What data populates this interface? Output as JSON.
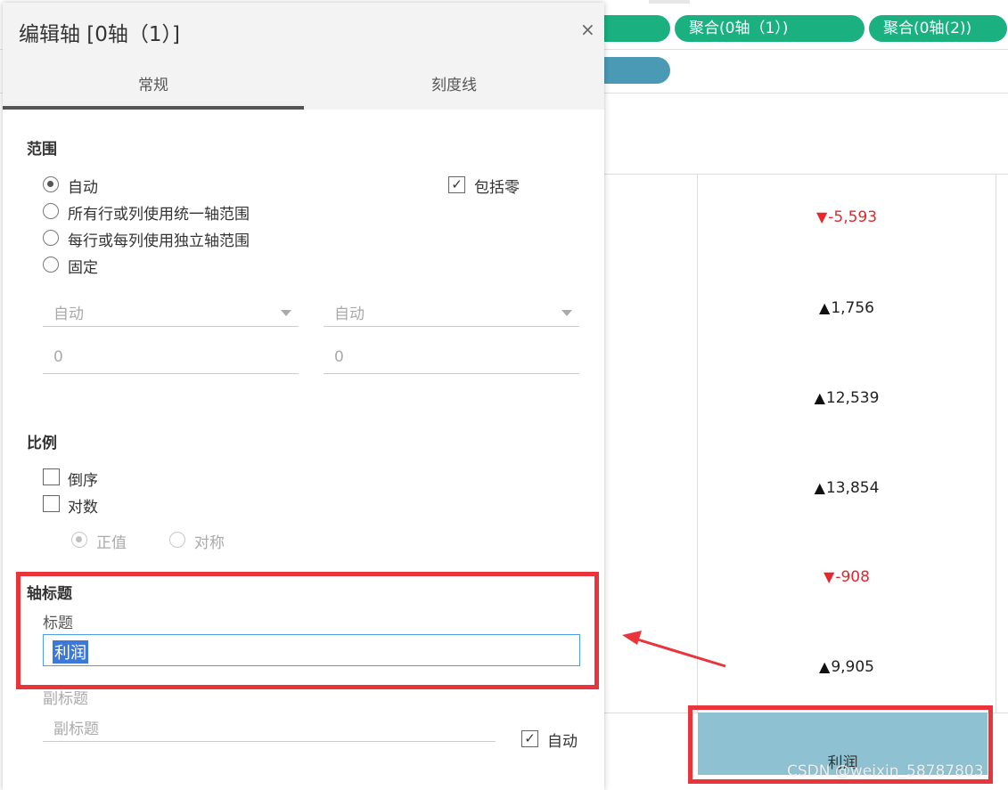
{
  "background": {
    "pills_row1": [
      "聚合(0轴（1）)",
      "聚合(0轴(2))"
    ],
    "values": [
      {
        "text": "-5,593",
        "trend": "down"
      },
      {
        "text": "1,756",
        "trend": "up"
      },
      {
        "text": "12,539",
        "trend": "up"
      },
      {
        "text": "13,854",
        "trend": "up"
      },
      {
        "text": "-908",
        "trend": "down"
      },
      {
        "text": "9,905",
        "trend": "up"
      }
    ],
    "axis_title": "利润",
    "watermark": "CSDN @weixin_58787803",
    "colors": {
      "pill_green": "#1ab07f",
      "pill_blue": "#4a9ab5",
      "negative": "#e8262c",
      "axis_fill": "#8ec1d1",
      "highlight": "#e9343b"
    }
  },
  "dialog": {
    "title": "编辑轴 [0轴（1）]",
    "close_icon": "×",
    "tabs": [
      {
        "label": "常规",
        "active": true
      },
      {
        "label": "刻度线",
        "active": false
      }
    ],
    "range": {
      "heading": "范围",
      "options": [
        "自动",
        "所有行或列使用统一轴范围",
        "每行或每列使用独立轴范围",
        "固定"
      ],
      "selected": "自动",
      "include_zero": {
        "label": "包括零",
        "checked": true
      },
      "start_select": "自动",
      "end_select": "自动",
      "start_value": "0",
      "end_value": "0"
    },
    "scale": {
      "heading": "比例",
      "reversed": {
        "label": "倒序",
        "checked": false
      },
      "log": {
        "label": "对数",
        "checked": false
      },
      "log_options": [
        "正值",
        "对称"
      ],
      "log_selected": "正值"
    },
    "axis_title": {
      "heading": "轴标题",
      "title_label": "标题",
      "title_value": "利润",
      "subtitle_label": "副标题",
      "subtitle_placeholder": "副标题",
      "subtitle_auto": {
        "label": "自动",
        "checked": true
      }
    }
  }
}
